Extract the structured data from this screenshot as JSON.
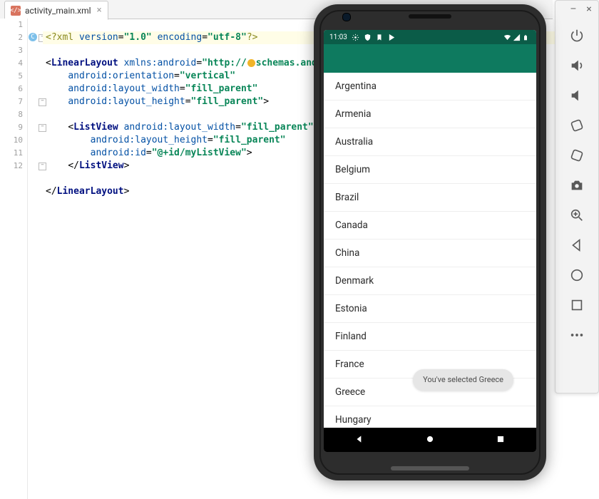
{
  "editor": {
    "tab_filename": "activity_main.xml",
    "line_numbers": [
      "1",
      "2",
      "3",
      "4",
      "5",
      "6",
      "7",
      "8",
      "9",
      "10",
      "11",
      "12"
    ],
    "xml": {
      "decl_preq": "<?",
      "decl_xml": "xml ",
      "decl_attr1_name": "version",
      "decl_attr1_val": "\"1.0\"",
      "decl_attr2_name": "encoding",
      "decl_attr2_val": "\"utf-8\"",
      "decl_postq": "?>",
      "ll_open": "<",
      "ll_tag": "LinearLayout ",
      "ll_ns_name": "xmlns:android",
      "ll_ns_val": "\"http://",
      "ll_ns_val2": "schemas.andro",
      "ll_attr_orient_name": "android:orientation",
      "ll_attr_orient_val": "\"vertical\"",
      "ll_attr_w_name": "android:layout_width",
      "ll_attr_w_val": "\"fill_parent\"",
      "ll_attr_h_name": "android:layout_height",
      "ll_attr_h_val": "\"fill_parent\"",
      "gt": ">",
      "lv_open": "<",
      "lv_tag": "ListView ",
      "lv_attr_w_name": "android:layout_width",
      "lv_attr_w_val": "\"fill_parent\"",
      "lv_attr_h_name": "android:layout_height",
      "lv_attr_h_val": "\"fill_parent\"",
      "lv_attr_id_name": "android:id",
      "lv_attr_id_val": "\"@+id/myListView\"",
      "lv_close": "</",
      "lv_close_tag": "ListView",
      "ll_close": "</",
      "ll_close_tag": "LinearLayout"
    }
  },
  "emulator": {
    "status_time": "11:03",
    "list_items": [
      "Argentina",
      "Armenia",
      "Australia",
      "Belgium",
      "Brazil",
      "Canada",
      "China",
      "Denmark",
      "Estonia",
      "Finland",
      "France",
      "Greece",
      "Hungary"
    ],
    "toast_text": "You've selected Greece"
  },
  "toolbar": {
    "close": "×",
    "min": "–"
  }
}
